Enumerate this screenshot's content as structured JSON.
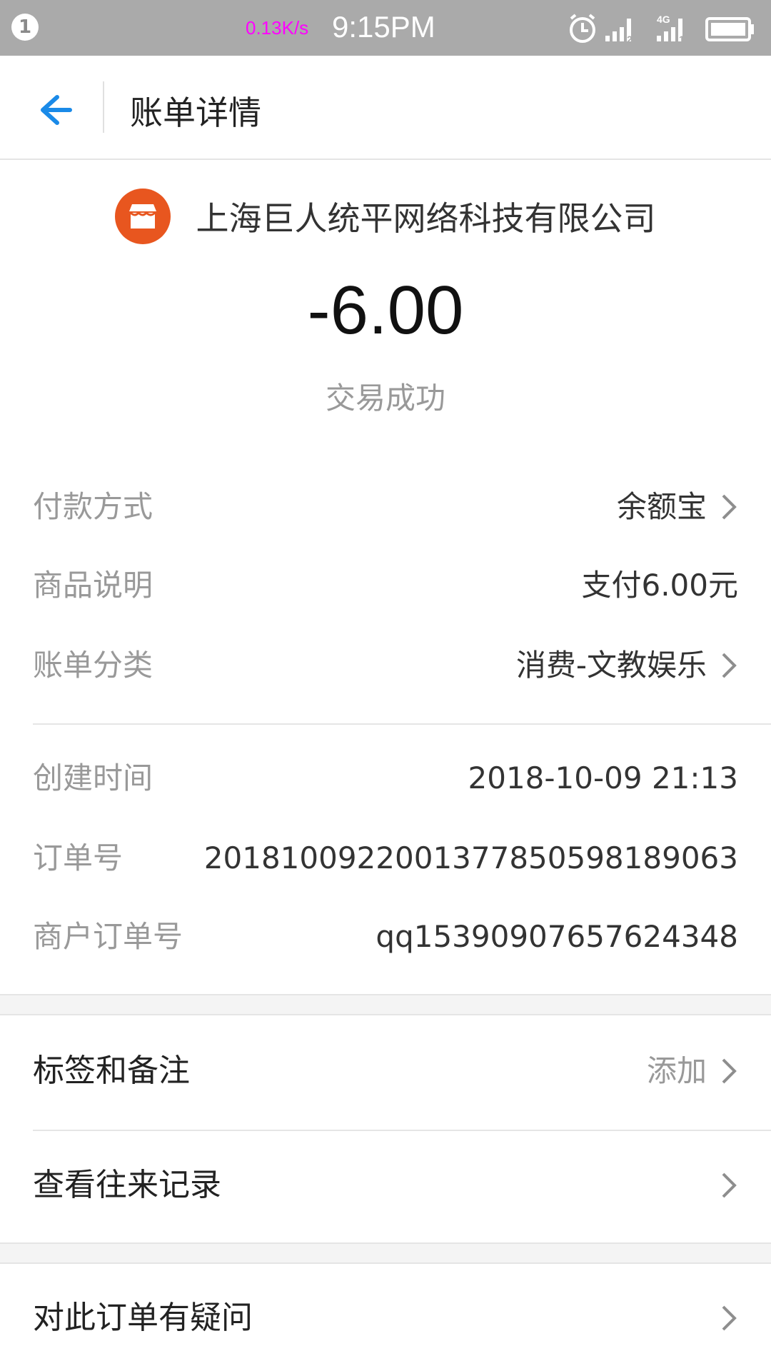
{
  "status_bar": {
    "notification_count": "1",
    "net_speed": "0.13K/s",
    "time": "9:15PM",
    "network_label": "4G",
    "sim1_label": "2",
    "sim2_label": "1"
  },
  "header": {
    "title": "账单详情"
  },
  "merchant": {
    "name": "上海巨人统平网络科技有限公司",
    "logo_color": "#e8561f"
  },
  "transaction": {
    "amount": "-6.00",
    "status": "交易成功"
  },
  "details": [
    {
      "label": "付款方式",
      "value": "余额宝"
    },
    {
      "label": "商品说明",
      "value": "支付6.00元"
    },
    {
      "label": "账单分类",
      "value": "消费-文教娱乐"
    }
  ],
  "details2": [
    {
      "label": "创建时间",
      "value": "2018-10-09 21:13"
    },
    {
      "label": "订单号",
      "value": "20181009220013778505981890​63"
    },
    {
      "label": "商户订单号",
      "value": "qq1539090765762434​8"
    }
  ],
  "actions": {
    "tags": {
      "label": "标签和备注",
      "hint": "添加"
    },
    "history": {
      "label": "查看往来记录"
    },
    "dispute": {
      "label": "对此订单有疑问"
    }
  },
  "colors": {
    "accent": "#1a8ae8",
    "status_bar": "#aaaaaa",
    "speed_text": "#ff00ff"
  }
}
